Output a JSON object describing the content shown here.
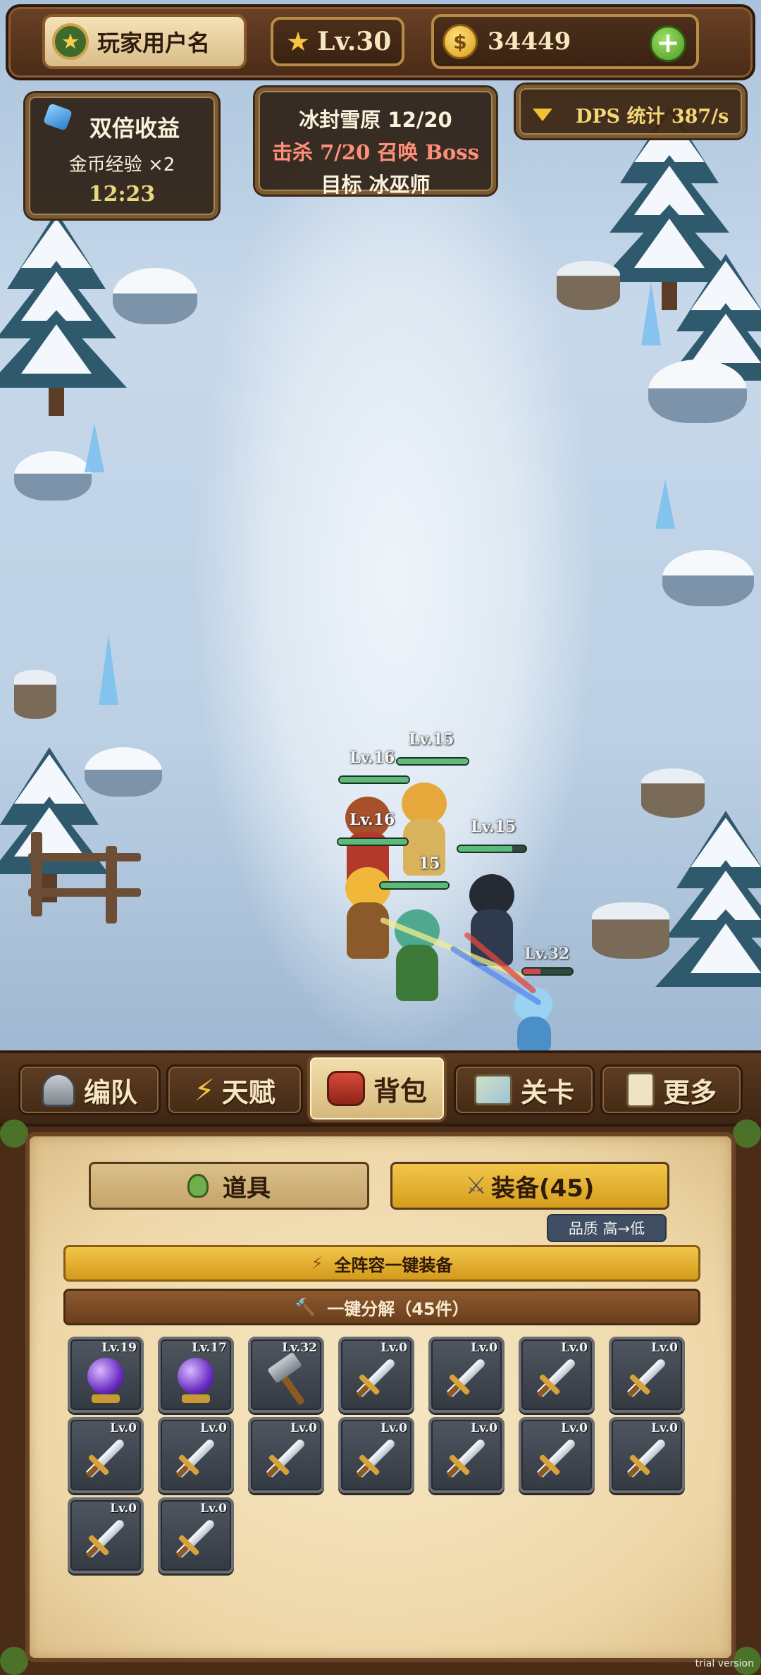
{
  "hud": {
    "username": "玩家用户名",
    "level": "Lv.30",
    "coins": "34449"
  },
  "buff_panel": {
    "title": "双倍收益",
    "subtitle": "金币经验 ×2",
    "timer": "12:23"
  },
  "stage_panel": {
    "stage": "冰封雪原  12/20",
    "kills": "击杀 7/20 召唤 Boss",
    "target": "目标 冰巫师"
  },
  "dps_panel": {
    "label": "DPS 统计 387/s"
  },
  "battle": {
    "heroes": [
      {
        "level": "Lv.16"
      },
      {
        "level": "Lv.15"
      },
      {
        "level": "Lv.16"
      },
      {
        "level": "Lv.15"
      },
      {
        "level": "15"
      }
    ],
    "enemy": {
      "level": "Lv.32"
    }
  },
  "tabs": [
    {
      "label": "编队",
      "icon": "helmet-icon"
    },
    {
      "label": "天赋",
      "icon": "lightning-icon"
    },
    {
      "label": "背包",
      "icon": "bag-icon",
      "active": true
    },
    {
      "label": "关卡",
      "icon": "map-icon"
    },
    {
      "label": "更多",
      "icon": "scroll-icon"
    }
  ],
  "inventory": {
    "subtabs": {
      "items": "道具",
      "equipment": "装备(45)"
    },
    "sort": "品质  高→低",
    "equip_all": "全阵容一键装备",
    "salvage_all": "一键分解（45件）",
    "slots": [
      {
        "level": "Lv.19",
        "item": "orb"
      },
      {
        "level": "Lv.17",
        "item": "orb"
      },
      {
        "level": "Lv.32",
        "item": "hammer"
      },
      {
        "level": "Lv.0",
        "item": "sword"
      },
      {
        "level": "Lv.0",
        "item": "sword"
      },
      {
        "level": "Lv.0",
        "item": "sword"
      },
      {
        "level": "Lv.0",
        "item": "sword"
      },
      {
        "level": "Lv.0",
        "item": "sword"
      },
      {
        "level": "Lv.0",
        "item": "sword"
      },
      {
        "level": "Lv.0",
        "item": "sword"
      },
      {
        "level": "Lv.0",
        "item": "sword"
      },
      {
        "level": "Lv.0",
        "item": "sword"
      },
      {
        "level": "Lv.0",
        "item": "sword"
      },
      {
        "level": "Lv.0",
        "item": "sword"
      },
      {
        "level": "Lv.0",
        "item": "sword"
      },
      {
        "level": "Lv.0",
        "item": "sword"
      }
    ]
  },
  "watermark": "trial version",
  "colors": {
    "wood": "#4a2c17",
    "parchment": "#f6e7c4",
    "gold": "#f0c64b",
    "hp_green": "#5dbb7a"
  }
}
